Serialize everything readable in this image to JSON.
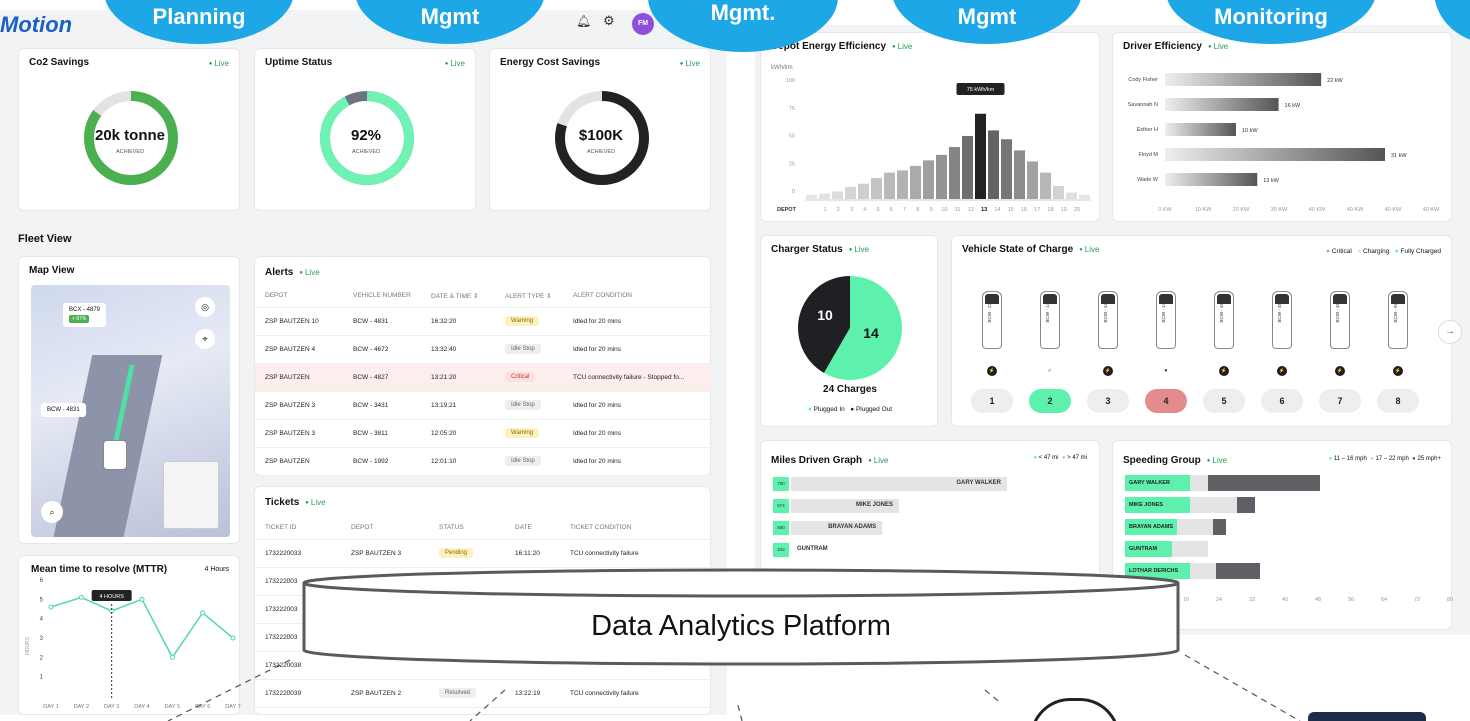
{
  "logo": "Motion",
  "bubbles": [
    "Planning",
    "Mgmt",
    "Mgmt.",
    "Mgmt",
    "Monitoring"
  ],
  "header": {
    "avatar": "FM"
  },
  "kpis": [
    {
      "title": "Co2 Savings",
      "live": "Live",
      "value": "20k tonne",
      "sub": "ACHIEVED",
      "progress": 0.85,
      "color": "#4caf50"
    },
    {
      "title": "Uptime Status",
      "live": "Live",
      "value": "92%",
      "sub": "ACHIEVED",
      "progress": 0.92,
      "color": "#6ff2b4"
    },
    {
      "title": "Energy Cost Savings",
      "live": "Live",
      "value": "$100K",
      "sub": "ACHIEVED",
      "progress": 0.8,
      "color": "#222222"
    }
  ],
  "fleet_view": {
    "title": "Fleet View"
  },
  "map": {
    "title": "Map View",
    "tag1": "BCX - 4879",
    "tag1_pct": "+ 87%",
    "tag2": "BCW - 4831"
  },
  "mttr": {
    "title": "Mean time to resolve (MTTR)",
    "unit": "4 Hours",
    "tooltip": "4 HOURS",
    "ylabel": "HOURS",
    "yticks": [
      "6",
      "5",
      "4",
      "3",
      "2",
      "1"
    ],
    "days": [
      "DAY 1",
      "DAY 2",
      "DAY 3",
      "DAY 4",
      "DAY 5",
      "DAY 6",
      "DAY 7"
    ],
    "values": [
      4.6,
      5.1,
      4.4,
      5.0,
      2.0,
      4.3,
      3.0
    ]
  },
  "alerts": {
    "title": "Alerts",
    "live": "Live",
    "headers": [
      "DEPOT",
      "VEHICLE NUMBER",
      "DATE & TIME ⇕",
      "ALERT TYPE ⇕",
      "ALERT CONDITION"
    ],
    "rows": [
      [
        "ZSP BAUTZEN 10",
        "BCW - 4831",
        "16:32:20",
        "Warning",
        "Idled for 20 mins"
      ],
      [
        "ZSP BAUTZEN 4",
        "BCW - 4672",
        "13:32:40",
        "Idle Stop",
        "Idled for 20 mins"
      ],
      [
        "ZSP BAUTZEN",
        "BCW - 4827",
        "13:21:20",
        "Critical",
        "TCU connectivity failure - Stopped fo..."
      ],
      [
        "ZSP BAUTZEN 3",
        "BCW - 3431",
        "13:19:21",
        "Idle Stop",
        "Idled for 20 mins"
      ],
      [
        "ZSP BAUTZEN 3",
        "BCW - 3811",
        "12:05:20",
        "Warning",
        "Idled for 20 mins"
      ],
      [
        "ZSP BAUTZEN",
        "BCW - 1992",
        "12:01:10",
        "Idle Stop",
        "Idled for 20 mins"
      ]
    ]
  },
  "tickets": {
    "title": "Tickets",
    "live": "Live",
    "headers": [
      "TICKET ID",
      "DEPOT",
      "STATUS",
      "DATE",
      "TICKET CONDITION"
    ],
    "rows": [
      [
        "1732220033",
        "ZSP BAUTZEN 3",
        "Pending",
        "16:11:20",
        "TCU connectivity failure"
      ],
      [
        "173222003",
        "",
        "",
        "",
        ""
      ],
      [
        "173222003",
        "",
        "",
        "",
        ""
      ],
      [
        "173222003",
        "",
        "",
        "",
        ""
      ],
      [
        "1732220038",
        "",
        "",
        "",
        ""
      ],
      [
        "1732220039",
        "ZSP BAUTZEN 2",
        "Resolved",
        "13:22:19",
        "TCU connectivity failure"
      ]
    ]
  },
  "depot_eff": {
    "title": "Depot Energy Efficiency",
    "live": "Live",
    "unit": "kWh/km",
    "tooltip": "75 kWh/km",
    "yticks": [
      "100",
      "75",
      "50",
      "25",
      "0"
    ],
    "xlabel": "DEPOT",
    "x": [
      "1",
      "2",
      "3",
      "4",
      "5",
      "6",
      "7",
      "8",
      "9",
      "10",
      "11",
      "12",
      "13",
      "14",
      "15",
      "16",
      "17",
      "18",
      "19",
      "20"
    ],
    "values": [
      2,
      3,
      5,
      9,
      12,
      17,
      22,
      24,
      28,
      33,
      38,
      45,
      55,
      75,
      60,
      52,
      42,
      32,
      22,
      10,
      4,
      2
    ]
  },
  "driver_eff": {
    "title": "Driver Efficiency",
    "live": "Live",
    "drivers": [
      {
        "name": "Cody Fisher",
        "value": 22,
        "label": "22 kW"
      },
      {
        "name": "Savannah N",
        "value": 16,
        "label": "16 kW"
      },
      {
        "name": "Esther H",
        "value": 10,
        "label": "10 kW"
      },
      {
        "name": "Floyd M",
        "value": 31,
        "label": "31 kW"
      },
      {
        "name": "Wade W",
        "value": 13,
        "label": "13 kW"
      }
    ],
    "xticks": [
      "0 KW",
      "10 KW",
      "20 KW",
      "30 KW",
      "40 KW",
      "40 KW",
      "40 KW",
      "40 KW"
    ]
  },
  "charger": {
    "title": "Charger Status",
    "live": "Live",
    "plugged_in": 14,
    "plugged_out": 10,
    "total": "24 Charges",
    "legend": [
      "Plugged In",
      "Plugged Out"
    ]
  },
  "soc": {
    "title": "Vehicle State of Charge",
    "live": "Live",
    "legend": [
      "Critical",
      "Charging",
      "Fully Charged"
    ],
    "vehicles": [
      {
        "id": "BCW - 2382",
        "num": "1",
        "state": "normal",
        "icon": "⚡"
      },
      {
        "id": "BCW - 1462",
        "num": "2",
        "state": "full",
        "icon": "✓"
      },
      {
        "id": "BCW - 4782",
        "num": "3",
        "state": "normal",
        "icon": "⚡"
      },
      {
        "id": "BCW - 1471",
        "num": "4",
        "state": "critical",
        "icon": "♥"
      },
      {
        "id": "BCW - 4531",
        "num": "5",
        "state": "normal",
        "icon": "⚡"
      },
      {
        "id": "BCW - 4532",
        "num": "6",
        "state": "normal",
        "icon": "⚡"
      },
      {
        "id": "BCW - 4533",
        "num": "7",
        "state": "normal",
        "icon": "⚡"
      },
      {
        "id": "BCW - 9745",
        "num": "8",
        "state": "normal",
        "icon": "⚡"
      }
    ]
  },
  "miles": {
    "title": "Miles Driven Graph",
    "live": "Live",
    "legend": [
      "< 47 mi",
      "> 47 mi"
    ],
    "rows": [
      {
        "badge": "780",
        "name": "GARY WALKER",
        "w": 0.9
      },
      {
        "badge": "674",
        "name": "MIKE JONES",
        "w": 0.45
      },
      {
        "badge": "590",
        "name": "BRAYAN ADAMS",
        "w": 0.38
      },
      {
        "badge": "342",
        "name": "GUNTRAM",
        "w": 0.0
      }
    ]
  },
  "speeding": {
    "title": "Speeding Group",
    "live": "Live",
    "legend": [
      "11 – 16 mph",
      "17 – 22 mph",
      "25 mph+"
    ],
    "rows": [
      {
        "name": "GARY WALKER",
        "a": 0.25,
        "b": 0.07,
        "c": 0.43
      },
      {
        "name": "MIKE JONES",
        "a": 0.25,
        "b": 0.18,
        "c": 0.07
      },
      {
        "name": "BRAYAN ADAMS",
        "a": 0.2,
        "b": 0.14,
        "c": 0.05
      },
      {
        "name": "GUNTRAM",
        "a": 0.18,
        "b": 0.14,
        "c": 0.0
      },
      {
        "name": "LOTHAR DERICHS",
        "a": 0.25,
        "b": 0.1,
        "c": 0.17
      }
    ],
    "xticks": [
      "16",
      "24",
      "32",
      "40",
      "48",
      "56",
      "64",
      "72",
      "80"
    ]
  },
  "platform": {
    "label": "Data Analytics Platform"
  }
}
